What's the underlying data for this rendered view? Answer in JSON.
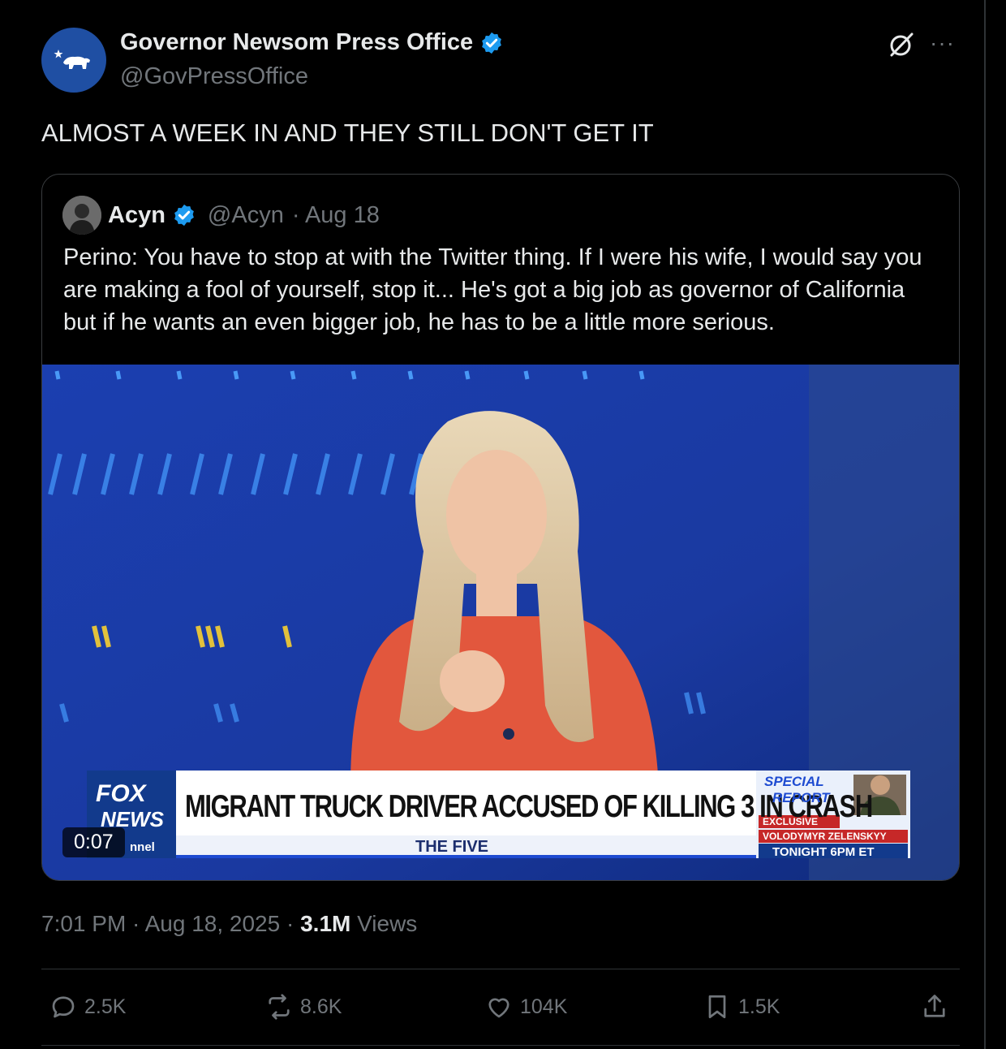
{
  "author": {
    "name": "Governor Newsom Press Office",
    "handle": "@GovPressOffice"
  },
  "tweet_text": "ALMOST A WEEK IN AND THEY STILL DON'T GET IT",
  "quote": {
    "name": "Acyn",
    "handle": "@Acyn",
    "date": "· Aug 18",
    "text": "Perino: You have to stop at with the Twitter thing. If I were his wife, I would say you are making a fool of yourself, stop it... He's got a big job as governor of California but if he wants an even bigger job, he has to be a little more serious.",
    "video": {
      "duration": "0:07",
      "chyron": "MIGRANT TRUCK DRIVER ACCUSED OF KILLING 3 IN CRASH",
      "show_label": "THE FIVE",
      "network_line1": "FOX",
      "network_line2": "NEWS",
      "network_line3": "nnel",
      "side_panel_title1": "SPECIAL",
      "side_panel_title2": "REPORT",
      "side_panel_exclusive": "EXCLUSIVE",
      "side_panel_name": "VOLODYMYR ZELENSKYY",
      "side_panel_time": "TONIGHT 6PM ET"
    }
  },
  "meta": {
    "time": "7:01 PM · Aug 18, 2025 · ",
    "views_count": "3.1M",
    "views_label": " Views"
  },
  "actions": {
    "replies": "2.5K",
    "reposts": "8.6K",
    "likes": "104K",
    "bookmarks": "1.5K"
  },
  "colors": {
    "verified": "#1d9bf0",
    "muted": "#71767b",
    "text": "#e7e9ea"
  }
}
